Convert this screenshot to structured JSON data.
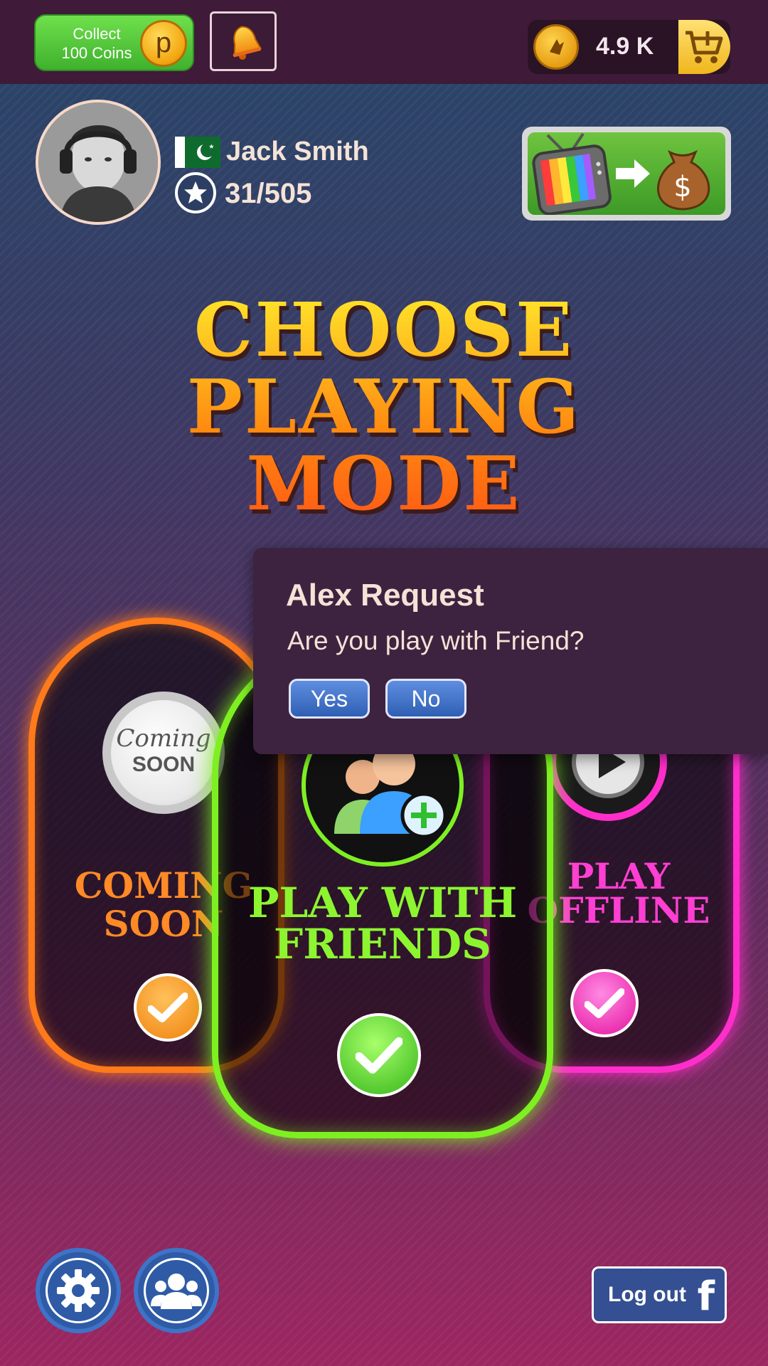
{
  "top_bar": {
    "collect_label": "Collect\n100 Coins",
    "collect_coin_letter": "p",
    "coin_balance": "4.9 K",
    "icons": {
      "bell": "bell-icon",
      "coin": "coin-icon",
      "cart": "cart-add-icon"
    }
  },
  "profile": {
    "name": "Jack Smith",
    "score": "31/505",
    "flag": "pakistan-flag",
    "icons": {
      "rank": "star-badge-icon",
      "promo": "tv-to-money-icon"
    }
  },
  "headline": {
    "lines": [
      "CHOOSE",
      "PLAYING",
      "MODE"
    ]
  },
  "modes": [
    {
      "key": "coming_soon",
      "badge_line1": "Coming",
      "badge_line2": "SOON",
      "title_line1": "COMING",
      "title_line2": "SOON",
      "color": "#ff7a1a"
    },
    {
      "key": "friends",
      "title_line1": "PLAY WITH",
      "title_line2": "FRIENDS",
      "color": "#7ef022"
    },
    {
      "key": "offline",
      "title_line1": "PLAY",
      "title_line2": "OFFLINE",
      "color": "#ff2ecb"
    }
  ],
  "dialog": {
    "title": "Alex Request",
    "message": "Are you play with Friend?",
    "yes_label": "Yes",
    "no_label": "No"
  },
  "bottom_bar": {
    "logout_label": "Log out",
    "facebook_glyph": "f",
    "icons": {
      "settings": "gear-icon",
      "friends": "friends-icon"
    }
  },
  "colors": {
    "accent_green": "#7ef022",
    "accent_orange": "#ff7a1a",
    "accent_pink": "#ff2ecb",
    "button_blue": "#2f5ba6"
  }
}
